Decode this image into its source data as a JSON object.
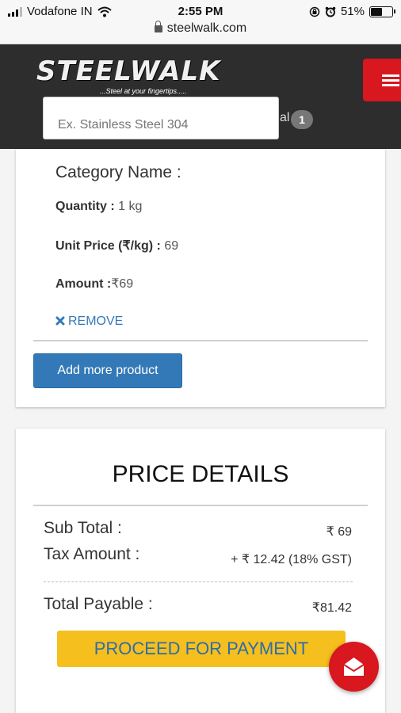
{
  "status_bar": {
    "carrier": "Vodafone IN",
    "time": "2:55 PM",
    "battery": "51%",
    "battery_level": 0.51,
    "url": "steelwalk.com"
  },
  "header": {
    "logo_text": "STEELWALK",
    "tagline": "...Steel at your fingertips.....",
    "search_placeholder": "Ex. Stainless Steel 304",
    "cart_label_fragment": "al",
    "cart_count": "1"
  },
  "product": {
    "category_label": "Category Name :",
    "quantity_label": "Quantity :",
    "quantity_value": "1 kg",
    "unit_price_label": "Unit Price (₹/kg) :",
    "unit_price_value": "69",
    "amount_label": "Amount :",
    "amount_value": "₹69",
    "remove_label": "REMOVE",
    "add_more_label": "Add more product"
  },
  "price_details": {
    "title": "PRICE DETAILS",
    "subtotal_label": "Sub Total :",
    "subtotal_value": "₹ 69",
    "tax_label": "Tax Amount :",
    "tax_value": "+ ₹ 12.42 (18% GST)",
    "total_label": "Total Payable :",
    "total_value": "₹81.42",
    "proceed_label": "PROCEED FOR PAYMENT"
  },
  "colors": {
    "brand_red": "#d8171f",
    "header_dark": "#2d2d2d",
    "primary_blue": "#3479b7",
    "cta_yellow": "#f5bf1e"
  },
  "icons": [
    "signal-icon",
    "wifi-icon",
    "lock-icon",
    "orientation-lock-icon",
    "alarm-icon",
    "battery-icon",
    "menu-icon",
    "close-icon",
    "mail-icon"
  ]
}
